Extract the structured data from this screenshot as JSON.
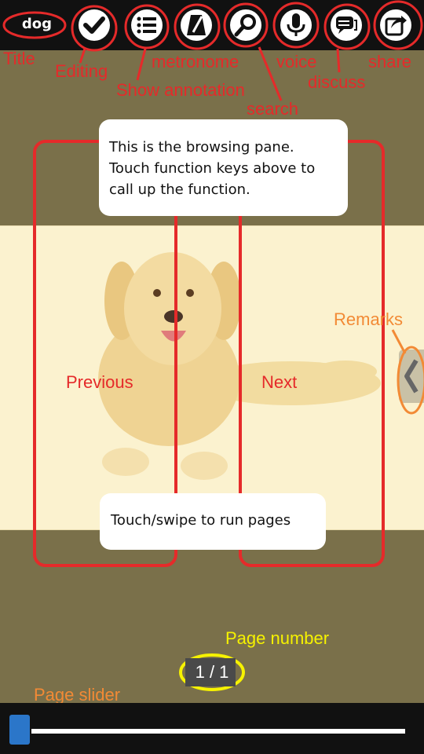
{
  "title": "dog",
  "toolbar": {
    "buttons": [
      {
        "name": "editing",
        "icon": "check-icon"
      },
      {
        "name": "show-annotation",
        "icon": "list-icon"
      },
      {
        "name": "metronome",
        "icon": "metronome-icon"
      },
      {
        "name": "search",
        "icon": "search-icon"
      },
      {
        "name": "voice",
        "icon": "microphone-icon"
      },
      {
        "name": "discuss",
        "icon": "chat-icon"
      },
      {
        "name": "share",
        "icon": "share-icon"
      }
    ]
  },
  "annotations": {
    "title": "Title",
    "editing": "Editing",
    "show_annotation": "Show annotation",
    "metronome": "metronome",
    "search": "search",
    "voice": "voice",
    "discuss": "discuss",
    "share": "share",
    "remarks": "Remarks",
    "page_number": "Page number",
    "page_slider": "Page slider"
  },
  "browsing_pane": {
    "instruction": "This is the browsing pane. Touch function keys above to call up the function.",
    "instruction_lines": [
      "This is the browsing pane.",
      "Touch function keys above to",
      "call up the function."
    ],
    "swipe_hint": "Touch/swipe to run pages",
    "previous_label": "Previous",
    "next_label": "Next"
  },
  "page_indicator": "1 / 1",
  "slider": {
    "value": 0.0
  },
  "colors": {
    "annotation_red": "#e52a2a",
    "annotation_orange": "#f28a35",
    "annotation_yellow": "#f6f200",
    "background": "#7a704a",
    "slider_thumb": "#2b76c9"
  }
}
